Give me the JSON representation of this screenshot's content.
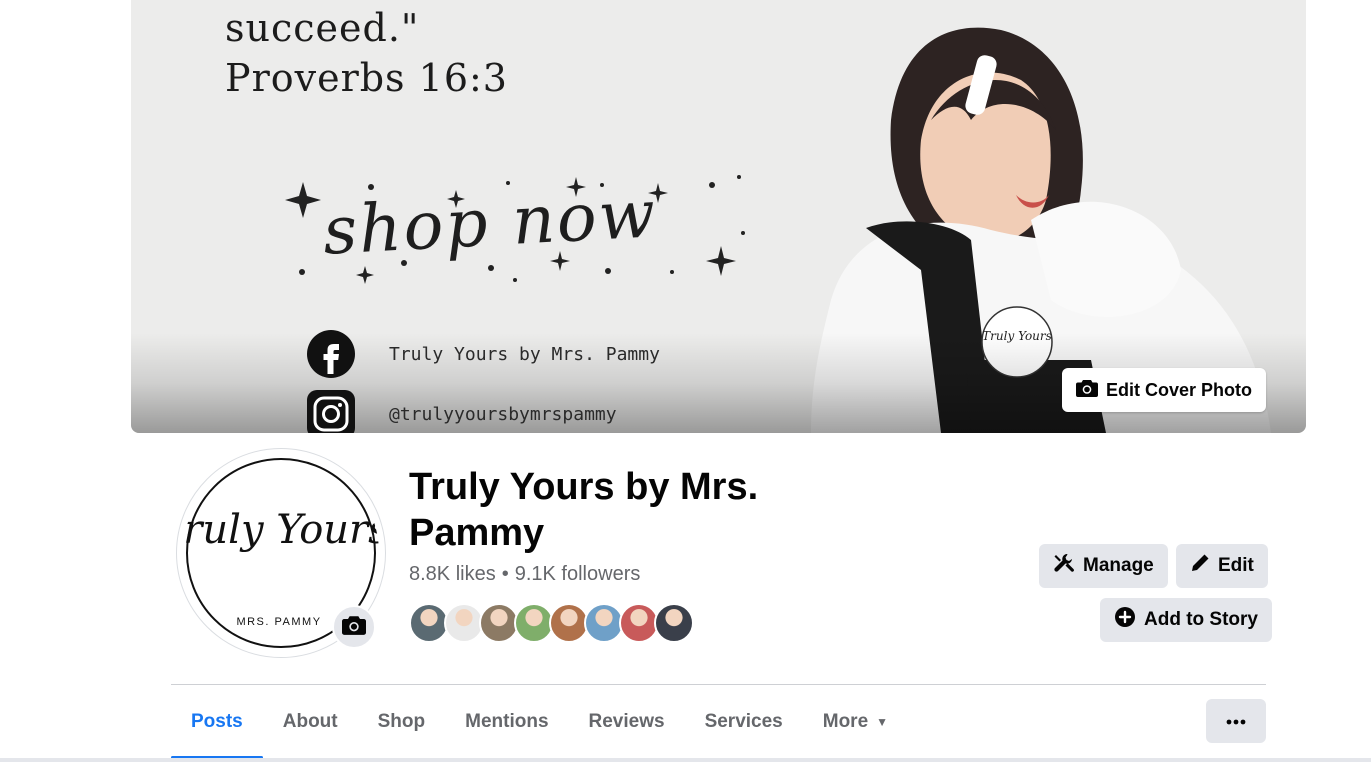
{
  "cover": {
    "quote_line_1": "succeed.\"",
    "quote_line_2": "Proverbs 16:3",
    "shop_now": "shop now",
    "facebook_handle": "Truly Yours by Mrs. Pammy",
    "instagram_handle": "@trulyyoursbymrspammy",
    "logo_script": "Truly Yours",
    "edit_cover_label": "Edit Cover Photo"
  },
  "profile": {
    "name": "Truly Yours by Mrs. Pammy",
    "likes": "8.8K likes",
    "separator": "•",
    "followers": "9.1K followers",
    "avatar_script": "Truly Yours,",
    "avatar_caption": "MRS. PAMMY"
  },
  "actions": {
    "manage_label": "Manage",
    "edit_label": "Edit",
    "add_story_label": "Add to Story"
  },
  "tabs": [
    {
      "label": "Posts",
      "active": true
    },
    {
      "label": "About"
    },
    {
      "label": "Shop"
    },
    {
      "label": "Mentions"
    },
    {
      "label": "Reviews"
    },
    {
      "label": "Services"
    },
    {
      "label": "More"
    }
  ],
  "follower_avatars": [
    {
      "color": "#5a6a72"
    },
    {
      "color": "#e9e9e9"
    },
    {
      "color": "#8c7a64"
    },
    {
      "color": "#7fae6a"
    },
    {
      "color": "#b0714a"
    },
    {
      "color": "#6fa0c8"
    },
    {
      "color": "#c85a5a"
    },
    {
      "color": "#3a3f4a"
    }
  ],
  "colors": {
    "accent": "#1877f2",
    "secondary_text": "#65676b",
    "button_bg": "#e4e6eb"
  }
}
